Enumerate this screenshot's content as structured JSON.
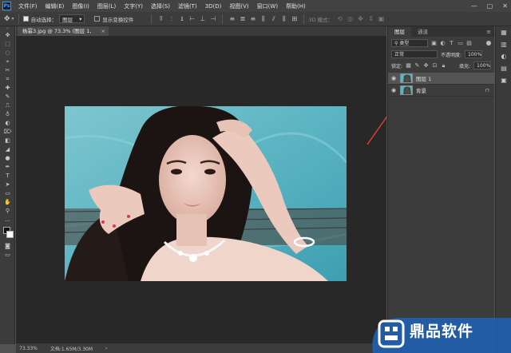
{
  "menubar": {
    "logo": "Ps",
    "items": [
      "文件(F)",
      "编辑(E)",
      "图像(I)",
      "图层(L)",
      "文字(Y)",
      "选择(S)",
      "滤镜(T)",
      "3D(D)",
      "视图(V)",
      "窗口(W)",
      "帮助(H)"
    ],
    "window_controls": [
      "—",
      "▢",
      "✕"
    ]
  },
  "options": {
    "auto_select_label": "自动选择：",
    "auto_select_value": "图层",
    "show_transform_label": "显示变换控件",
    "mode_3d_label": "3D 模式："
  },
  "tools": [
    "✥",
    "⬚",
    "◌",
    "⌖",
    "✂",
    "⌗",
    "✚",
    "✎",
    "⎍",
    "♁",
    "◐",
    "⌦",
    "◧",
    "◢",
    "●",
    "✒",
    "T",
    "➤",
    "▭",
    "✋",
    "⚲",
    "…"
  ],
  "document": {
    "tab_title": "杨幂3.jpg @ 73.3% (图层 1, RGB/8#) *",
    "zoom_status": "73.33%",
    "doc_status": "文档:1.65M/3.30M"
  },
  "layers_panel": {
    "tabs": [
      "图层",
      "通道"
    ],
    "filter_label": "类型",
    "blend_mode": "正常",
    "opacity_label": "不透明度:",
    "opacity_value": "100%",
    "lock_label": "锁定:",
    "fill_label": "填充:",
    "fill_value": "100%",
    "layers": [
      {
        "name": "图层 1",
        "selected": true,
        "locked": false
      },
      {
        "name": "背景",
        "selected": false,
        "locked": true
      }
    ]
  },
  "watermark": {
    "text": "鼎品软件"
  },
  "colors": {
    "accent": "#2fa3f7",
    "annotation_arrow": "#e03a3a",
    "watermark_bg": "#1f5fb0"
  }
}
